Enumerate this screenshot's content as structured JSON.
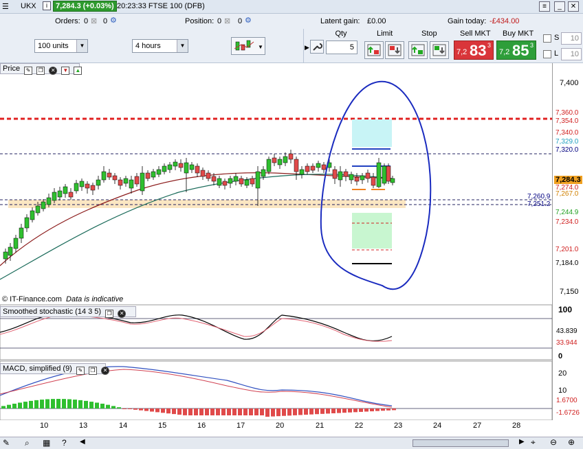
{
  "window": {
    "symbol": "UKX",
    "price_badge": "7,284.3 (+0.03%)",
    "title_rest": "20:23:33 FTSE 100 (DFB)"
  },
  "toolbar": {
    "orders_label": "Orders:",
    "orders_value": "0",
    "position_label": "Position:",
    "position_value": "0",
    "position_value2": "0",
    "orders_value2": "0",
    "latent_label": "Latent gain:",
    "latent_value": "£0.00",
    "gain_label": "Gain today:",
    "gain_value": "-£434.00",
    "units_select": "100 units",
    "interval_select": "4 hours",
    "qty_label": "Qty",
    "qty_value": "5",
    "limit_label": "Limit",
    "stop_label": "Stop",
    "sell_label": "Sell MKT",
    "buy_label": "Buy MKT",
    "sell_small": "7,2",
    "sell_big": "83",
    "sell_sup": "3",
    "buy_small": "7,2",
    "buy_big": "85",
    "buy_sup": "3",
    "s_label": "S",
    "l_label": "L",
    "s_value": "10",
    "l_value": "10"
  },
  "price_panel": {
    "title": "Price",
    "credit": "© IT-Finance.com",
    "credit_note": "Data is indicative",
    "y_ticks": [
      "7,400",
      "7,150"
    ],
    "price_tags": [
      {
        "label": "7,360.0",
        "color": "#d02020"
      },
      {
        "label": "7,354.0",
        "color": "#d02020"
      },
      {
        "label": "7,340.0",
        "color": "#d02020"
      },
      {
        "label": "7,329.0",
        "color": "#20a0c0"
      },
      {
        "label": "7,320.0",
        "color": "#000080"
      },
      {
        "label": "7,284.3",
        "color": "#d08000"
      },
      {
        "label": "7,274.0",
        "color": "#d02020"
      },
      {
        "label": "7,267.0",
        "color": "#d08000"
      },
      {
        "label": "7,244.9",
        "color": "#20a020"
      },
      {
        "label": "7,234.0",
        "color": "#d02020"
      },
      {
        "label": "7,201.0",
        "color": "#d02020"
      },
      {
        "label": "7,184.0",
        "color": "#000000"
      }
    ],
    "level_labels": [
      "7,260.9",
      "7,251.2"
    ]
  },
  "stoch_panel": {
    "title": "Smoothed stochastic (14 3 5)",
    "y_top": "100",
    "y_bottom": "0",
    "value1": "43.839",
    "value2": "33.944"
  },
  "macd_panel": {
    "title": "MACD, simplified (9)",
    "y_ticks": [
      "20",
      "10"
    ],
    "value1": "1.6700",
    "value2": "-1.6726"
  },
  "x_axis": [
    "10",
    "13",
    "14",
    "15",
    "16",
    "17",
    "20",
    "21",
    "22",
    "23",
    "24",
    "27",
    "28"
  ],
  "colors": {
    "up": "#2fbf2f",
    "down": "#e04a4a",
    "annotation": "#1a2bbf"
  }
}
